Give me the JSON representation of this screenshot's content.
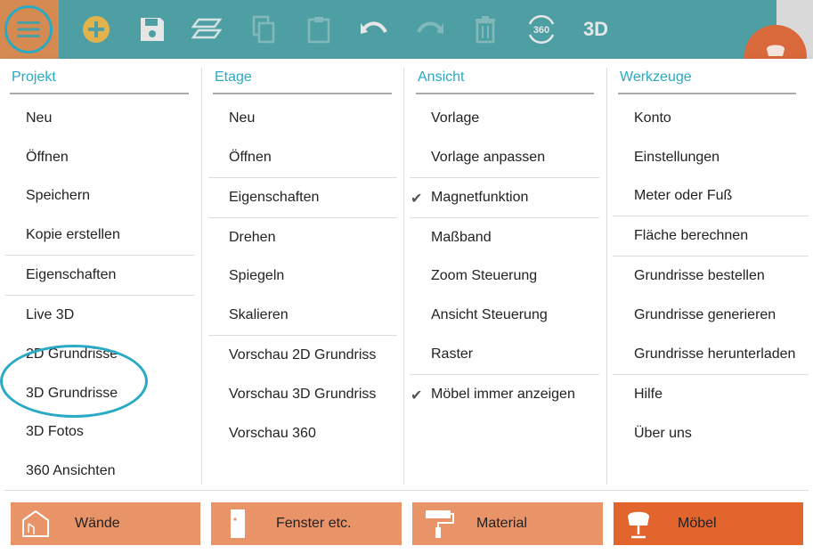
{
  "toolbar": {
    "icons": [
      "menu-icon",
      "add-icon",
      "save-icon",
      "layers-icon",
      "copy-icon",
      "paste-icon",
      "undo-icon",
      "redo-icon",
      "delete-icon",
      "rotate-360-icon",
      "3d-view-icon",
      "chair-icon"
    ],
    "label_360": "360",
    "label_3d": "3D"
  },
  "columns": {
    "projekt": {
      "title": "Projekt",
      "items": [
        "Neu",
        "Öffnen",
        "Speichern",
        "Kopie erstellen",
        "Eigenschaften",
        "Live 3D",
        "2D Grundrisse",
        "3D Grundrisse",
        "3D Fotos",
        "360 Ansichten"
      ]
    },
    "etage": {
      "title": "Etage",
      "items": [
        "Neu",
        "Öffnen",
        "Eigenschaften",
        "Drehen",
        "Spiegeln",
        "Skalieren",
        "Vorschau 2D Grundriss",
        "Vorschau 3D Grundriss",
        "Vorschau 360"
      ]
    },
    "ansicht": {
      "title": "Ansicht",
      "items": [
        "Vorlage",
        "Vorlage anpassen",
        "Magnetfunktion",
        "Maßband",
        "Zoom Steuerung",
        "Ansicht Steuerung",
        "Raster",
        "Möbel immer anzeigen"
      ],
      "checkmark": "✔"
    },
    "werkzeuge": {
      "title": "Werkzeuge",
      "items": [
        "Konto",
        "Einstellungen",
        "Meter oder Fuß",
        "Fläche berechnen",
        "Grundrisse bestellen",
        "Grundrisse generieren",
        "Grundrisse herunterladen",
        "Hilfe",
        "Über uns"
      ]
    }
  },
  "categories": [
    {
      "label": "Wände",
      "icon": "house-icon"
    },
    {
      "label": "Fenster etc.",
      "icon": "door-icon"
    },
    {
      "label": "Material",
      "icon": "paint-roller-icon"
    },
    {
      "label": "Möbel",
      "icon": "chair-icon"
    }
  ],
  "colors": {
    "toolbar": "#4e9fa3",
    "accent": "#29a9c3",
    "category": "#e99468",
    "category_active": "#e2652e"
  }
}
